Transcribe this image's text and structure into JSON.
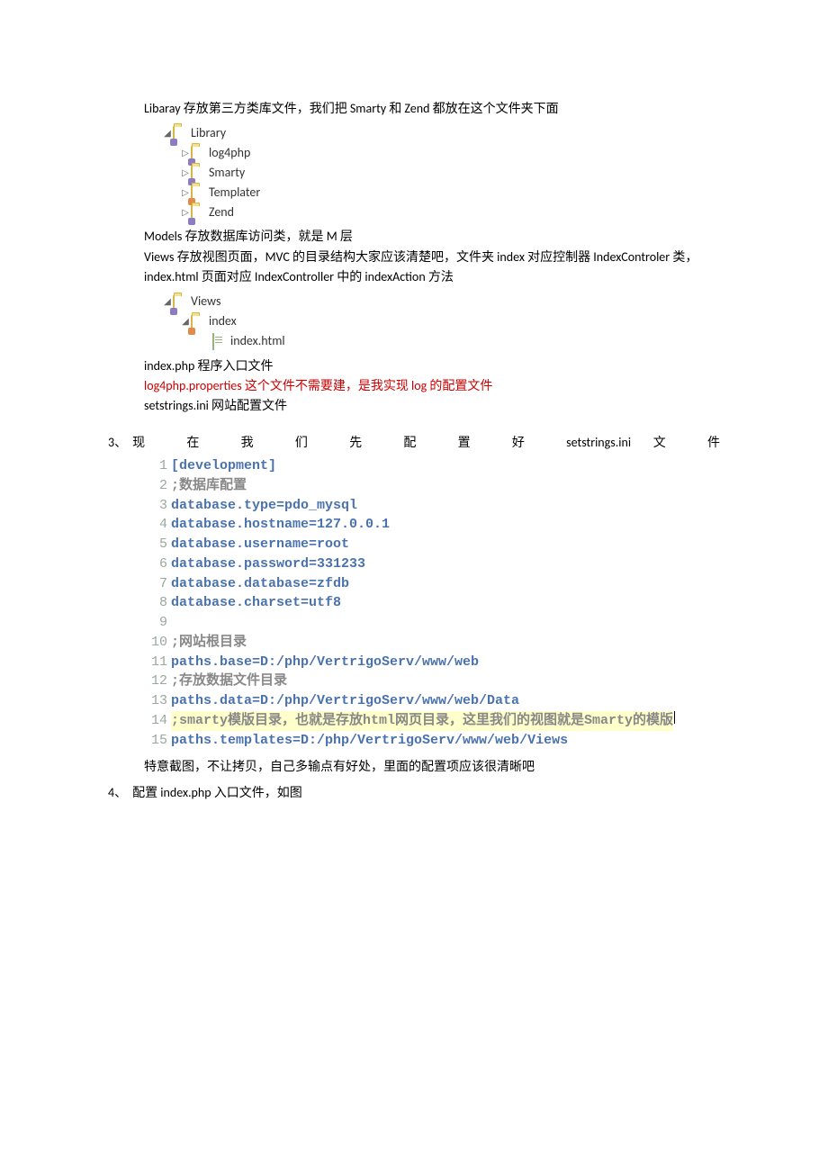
{
  "para_library": "Libaray 存放第三方类库文件，我们把 Smarty 和 Zend 都放在这个文件夹下面",
  "tree_library": {
    "root": "Library",
    "items": [
      "log4php",
      "Smarty",
      "Templater",
      "Zend"
    ]
  },
  "para_models": "Models 存放数据库访问类，就是 M 层",
  "para_views": "Views 存放视图页面，MVC 的目录结构大家应该清楚吧，文件夹 index 对应控制器 IndexControler 类，index.html 页面对应 IndexController 中的 indexAction 方法",
  "tree_views": {
    "root": "Views",
    "sub": "index",
    "file": "index.html"
  },
  "para_indexphp": "index.php 程序入口文件",
  "para_log4php": "log4php.properties 这个文件不需要建，是我实现 log 的配置文件",
  "para_setstrings": "setstrings.ini 网站配置文件",
  "item3_no": "3、",
  "item3_header": "现 在 我 们 先 配 置 好 setstrings.ini 文 件",
  "code_lines": [
    {
      "n": "1",
      "t": "[development]",
      "cls": ""
    },
    {
      "n": "2",
      "t": ";数据库配置",
      "cls": "cmt-strong"
    },
    {
      "n": "3",
      "t": "database.type=pdo_mysql",
      "cls": ""
    },
    {
      "n": "4",
      "t": "database.hostname=127.0.0.1",
      "cls": ""
    },
    {
      "n": "5",
      "t": "database.username=root",
      "cls": ""
    },
    {
      "n": "6",
      "t": "database.password=331233",
      "cls": ""
    },
    {
      "n": "7",
      "t": "database.database=zfdb",
      "cls": ""
    },
    {
      "n": "8",
      "t": "database.charset=utf8",
      "cls": ""
    },
    {
      "n": "9",
      "t": "",
      "cls": ""
    },
    {
      "n": "10",
      "t": ";网站根目录",
      "cls": "cmt-strong"
    },
    {
      "n": "11",
      "t": "paths.base=D:/php/VertrigoServ/www/web",
      "cls": ""
    },
    {
      "n": "12",
      "t": ";存放数据文件目录",
      "cls": "cmt-strong"
    },
    {
      "n": "13",
      "t": "paths.data=D:/php/VertrigoServ/www/web/Data",
      "cls": ""
    },
    {
      "n": "14",
      "t": ";smarty模版目录，也就是存放html网页目录，这里我们的视图就是Smarty的模版",
      "cls": "cmt-strong hl",
      "cursor": true
    },
    {
      "n": "15",
      "t": "paths.templates=D:/php/VertrigoServ/www/web/Views",
      "cls": ""
    }
  ],
  "item3_note": "特意截图，不让拷贝，自己多输点有好处，里面的配置项应该很清晰吧",
  "item4_no": "4、",
  "item4_text": "配置 index.php 入口文件，如图"
}
